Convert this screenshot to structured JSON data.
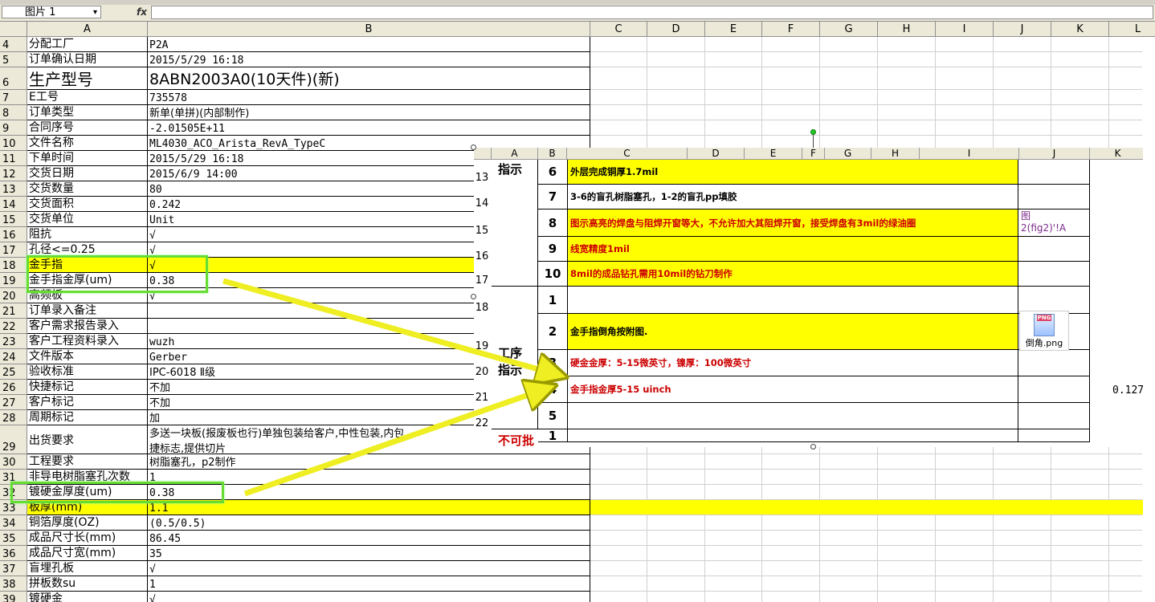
{
  "name_box": {
    "value": "图片 1",
    "arrow": "▾"
  },
  "formula_bar": {
    "fx_label": "fx",
    "value": ""
  },
  "columns": [
    "A",
    "B",
    "C",
    "D",
    "E",
    "F",
    "G",
    "H",
    "I",
    "J",
    "K",
    "L"
  ],
  "rows": [
    {
      "num": "4",
      "label": "分配工厂",
      "value": "P2A"
    },
    {
      "num": "5",
      "label": "订单确认日期",
      "value": "2015/5/29 16:18"
    },
    {
      "num": "6",
      "label": "生产型号",
      "value": "8ABN2003A0(10天件)(新)"
    },
    {
      "num": "7",
      "label": "E工号",
      "value": "735578"
    },
    {
      "num": "8",
      "label": "订单类型",
      "value": "新单(单拼)(内部制作)"
    },
    {
      "num": "9",
      "label": "合同序号",
      "value": "-2.01505E+11"
    },
    {
      "num": "10",
      "label": "文件名称",
      "value": "ML4030_ACO_Arista_RevA_TypeC"
    },
    {
      "num": "11",
      "label": "下单时间",
      "value": "2015/5/29 16:18"
    },
    {
      "num": "12",
      "label": "交货日期",
      "value": "2015/6/9 14:00"
    },
    {
      "num": "13",
      "label": "交货数量",
      "value": "80"
    },
    {
      "num": "14",
      "label": "交货面积",
      "value": "0.242"
    },
    {
      "num": "15",
      "label": "交货单位",
      "value": "Unit"
    },
    {
      "num": "16",
      "label": "阻抗",
      "value": "√"
    },
    {
      "num": "17",
      "label": "孔径<=0.25",
      "value": "√"
    },
    {
      "num": "18",
      "label": "金手指",
      "value": "√"
    },
    {
      "num": "19",
      "label": "金手指金厚(um)",
      "value": "0.38"
    },
    {
      "num": "20",
      "label": "高频板",
      "value": "√"
    },
    {
      "num": "21",
      "label": "订单录入备注",
      "value": ""
    },
    {
      "num": "22",
      "label": "客户需求报告录入",
      "value": ""
    },
    {
      "num": "23",
      "label": "客户工程资料录入",
      "value": "wuzh"
    },
    {
      "num": "24",
      "label": "文件版本",
      "value": "Gerber"
    },
    {
      "num": "25",
      "label": "验收标准",
      "value": "IPC-6018 Ⅱ级"
    },
    {
      "num": "26",
      "label": "快捷标记",
      "value": "不加"
    },
    {
      "num": "27",
      "label": "客户标记",
      "value": "不加"
    },
    {
      "num": "28",
      "label": "周期标记",
      "value": "加"
    },
    {
      "num": "29",
      "label": "出货要求",
      "value": "多送一块板(报废板也行)单独包装给客户,中性包装,内包",
      "value2": "捷标志,提供切片"
    },
    {
      "num": "30",
      "label": "工程要求",
      "value": "树脂塞孔，p2制作"
    },
    {
      "num": "31",
      "label": "非导电树脂塞孔次数",
      "value": "1"
    },
    {
      "num": "32",
      "label": "镀硬金厚度(um)",
      "value": "0.38"
    },
    {
      "num": "33",
      "label": "板厚(mm)",
      "value": "1.1"
    },
    {
      "num": "34",
      "label": "铜箔厚度(OZ)",
      "value": "(0.5/0.5)"
    },
    {
      "num": "35",
      "label": "成品尺寸长(mm)",
      "value": "86.45"
    },
    {
      "num": "36",
      "label": "成品尺寸宽(mm)",
      "value": "35"
    },
    {
      "num": "37",
      "label": "盲埋孔板",
      "value": "√"
    },
    {
      "num": "38",
      "label": "拼板数su",
      "value": "1"
    },
    {
      "num": "39",
      "label": "镀硬金",
      "value": "√"
    }
  ],
  "embedded": {
    "columns": [
      "A",
      "B",
      "C",
      "D",
      "E",
      "F",
      "G",
      "H",
      "I",
      "J",
      "K"
    ],
    "row_numbers": [
      "13",
      "14",
      "15",
      "16",
      "17",
      "18",
      "19",
      "20",
      "21",
      "22"
    ],
    "section_labels": {
      "top": "指示",
      "middle": "工序",
      "middle2": "指示",
      "bottom": "不可批"
    },
    "items": [
      {
        "num": "6",
        "text": "外层完成铜厚1.7mil",
        "red": false,
        "yellow": true
      },
      {
        "num": "7",
        "text": "3-6的盲孔树脂塞孔，1-2的盲孔pp填胶",
        "red": false,
        "yellow": false
      },
      {
        "num": "8",
        "text": "图示高亮的焊盘与阻焊开窗等大，不允许加大其阻焊开窗，接受焊盘有3mil的绿油圈",
        "red": true,
        "yellow": true
      },
      {
        "num": "9",
        "text": "线宽精度1mil",
        "red": true,
        "yellow": true
      },
      {
        "num": "10",
        "text": "8mil的成品钻孔需用10mil的钻刀制作",
        "red": true,
        "yellow": true
      },
      {
        "num": "1",
        "text": "",
        "red": false,
        "yellow": false
      },
      {
        "num": "2",
        "text": "金手指倒角按附图.",
        "red": false,
        "yellow": true
      },
      {
        "num": "3",
        "text": "硬金金厚：5-15微英寸，镍厚：100微英寸",
        "red": true,
        "yellow": false
      },
      {
        "num": "4",
        "text": "金手指金厚5-15 uinch",
        "red": true,
        "yellow": false
      },
      {
        "num": "5",
        "text": "",
        "red": false,
        "yellow": false
      },
      {
        "num": "1",
        "text": "",
        "red": false,
        "yellow": false
      }
    ],
    "j_link_line1": "图",
    "j_link_line2": "2(fig2)'!A",
    "attachment": {
      "badge": "PNG",
      "filename": "倒角.png"
    },
    "k_value": "0.127"
  },
  "highlight_color": "#ffff00",
  "callout_color": "#66dd33",
  "arrow_color": "#eeee22"
}
